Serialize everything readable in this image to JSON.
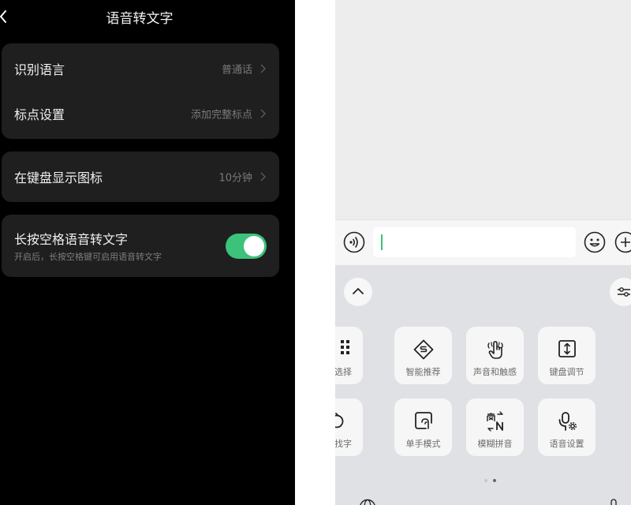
{
  "left_screen": {
    "title": "语音转文字",
    "rows": [
      {
        "label": "识别语言",
        "value": "普通话"
      },
      {
        "label": "标点设置",
        "value": "添加完整标点"
      }
    ],
    "keyboard_icon": {
      "label": "在键盘显示图标",
      "value": "10分钟"
    },
    "long_press": {
      "title": "长按空格语音转文字",
      "subtitle": "开启后，长按空格键可启用语音转文字",
      "enabled": true
    }
  },
  "right_screen": {
    "tools_row1": [
      {
        "label": "选择",
        "icon": "grid-icon"
      },
      {
        "label": "智能推荐",
        "icon": "smart-recommend-icon"
      },
      {
        "label": "声音和触感",
        "icon": "sound-touch-icon"
      },
      {
        "label": "键盘调节",
        "icon": "keyboard-adjust-icon"
      }
    ],
    "tools_row2": [
      {
        "label": "找字",
        "icon": "find-char-icon"
      },
      {
        "label": "单手模式",
        "icon": "one-hand-icon"
      },
      {
        "label": "模糊拼音",
        "icon": "fuzzy-pinyin-icon"
      },
      {
        "label": "语音设置",
        "icon": "voice-settings-icon"
      }
    ],
    "page_indicator": {
      "count": 2,
      "active": 2
    }
  },
  "colors": {
    "toggle_on": "#3cc27b",
    "cursor": "#3cc27b",
    "card_bg": "#1f1f1f"
  }
}
